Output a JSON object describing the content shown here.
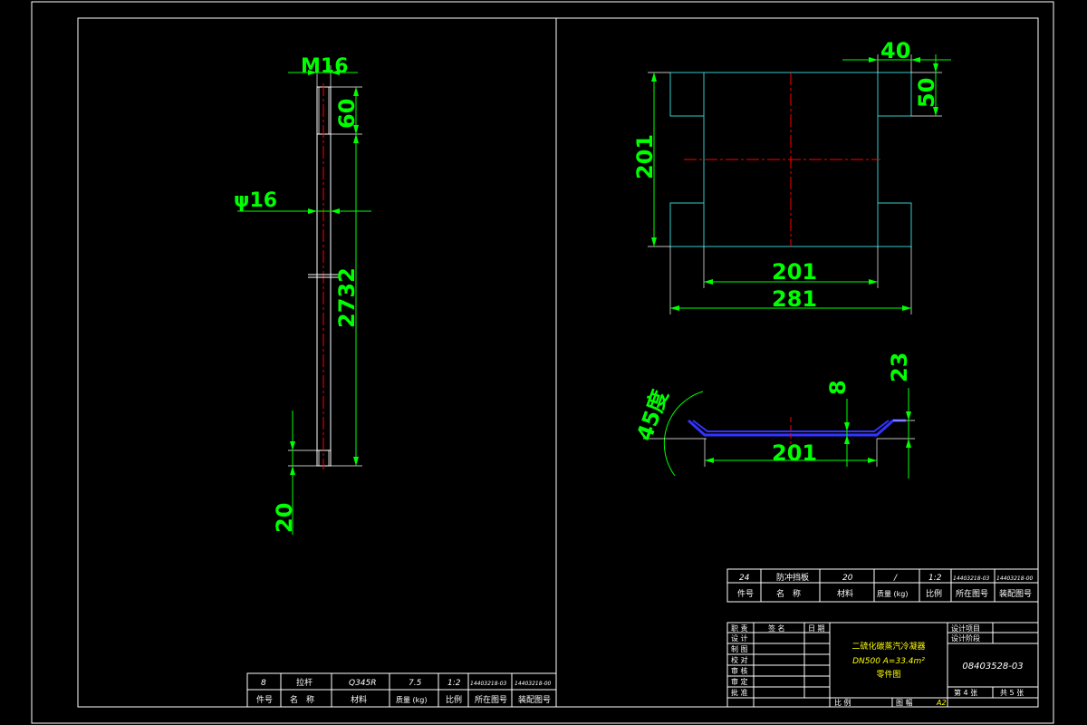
{
  "rod_view": {
    "dim_thread": "M16",
    "dim_top_length": "60",
    "dim_diameter": "ψ16",
    "dim_main_length": "2732",
    "dim_bottom_length": "20"
  },
  "plate_view": {
    "dim_tab_width": "40",
    "dim_tab_height": "50",
    "dim_height": "201",
    "dim_inner_width": "201",
    "dim_outer_width": "281"
  },
  "section_view": {
    "dim_angle": "45度",
    "dim_thickness": "8",
    "dim_depth": "23",
    "dim_bottom_width": "201"
  },
  "left_parts_table": {
    "row": [
      "8",
      "拉杆",
      "Q345R",
      "7.5",
      "1:2",
      "14403218-03",
      "14403218-00"
    ],
    "header": [
      "件号",
      "名　称",
      "材料",
      "质量 (kg)",
      "比例",
      "所在图号",
      "装配图号"
    ]
  },
  "right_parts_table": {
    "row": [
      "24",
      "防冲挡板",
      "20",
      "/",
      "1:2",
      "14403218-03",
      "14403218-00"
    ],
    "header": [
      "件号",
      "名　称",
      "材料",
      "质量 (kg)",
      "比例",
      "所在图号",
      "装配图号"
    ]
  },
  "title_block": {
    "sign_headers": [
      "职 责",
      "签 名",
      "日 期"
    ],
    "roles": [
      "设 计",
      "制 图",
      "校 对",
      "审 核",
      "审 定",
      "批 准"
    ],
    "title_line1": "二硫化碳蒸汽冷凝器",
    "title_line2": "DN500  A=33.4m²",
    "title_line3": "零件图",
    "project_label": "设计项目",
    "stage_label": "设计阶段",
    "drawing_number": "08403528-03",
    "scale_label": "比 例",
    "size_label": "图 幅",
    "size_value": "A2",
    "sheet": "第 4 张",
    "total": "共 5 张"
  }
}
